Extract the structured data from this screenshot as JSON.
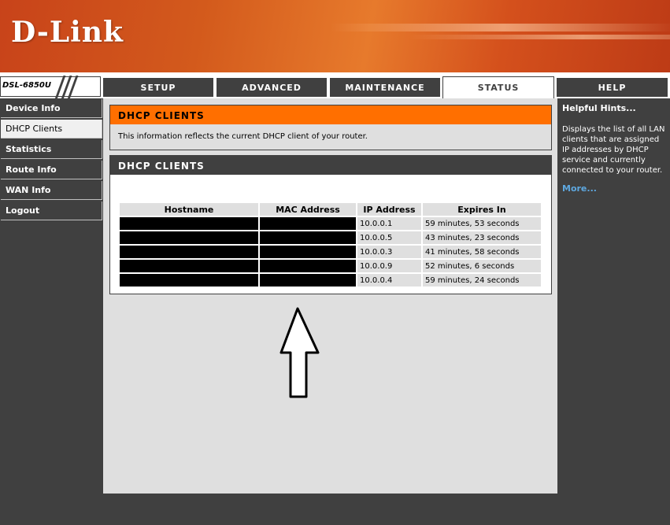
{
  "brand": {
    "logo_text": "D-Link",
    "model": "DSL-6850U"
  },
  "tabs": [
    {
      "label": "SETUP",
      "active": false
    },
    {
      "label": "ADVANCED",
      "active": false
    },
    {
      "label": "MAINTENANCE",
      "active": false
    },
    {
      "label": "STATUS",
      "active": true
    },
    {
      "label": "HELP",
      "active": false
    }
  ],
  "sidebar": {
    "items": [
      {
        "label": "Device Info",
        "active": false
      },
      {
        "label": "DHCP Clients",
        "active": true
      },
      {
        "label": "Statistics",
        "active": false
      },
      {
        "label": "Route Info",
        "active": false
      },
      {
        "label": "WAN Info",
        "active": false
      },
      {
        "label": "Logout",
        "active": false
      }
    ]
  },
  "main": {
    "info_title": "DHCP CLIENTS",
    "info_text": "This information reflects the current DHCP client of your router.",
    "table_title": "DHCP CLIENTS",
    "columns": [
      "Hostname",
      "MAC Address",
      "IP Address",
      "Expires In"
    ],
    "rows": [
      {
        "ip": "10.0.0.1",
        "expires": "59 minutes, 53 seconds"
      },
      {
        "ip": "10.0.0.5",
        "expires": "43 minutes, 23 seconds"
      },
      {
        "ip": "10.0.0.3",
        "expires": "41 minutes, 58 seconds"
      },
      {
        "ip": "10.0.0.9",
        "expires": "52 minutes, 6 seconds"
      },
      {
        "ip": "10.0.0.4",
        "expires": "59 minutes, 24 seconds"
      }
    ]
  },
  "help": {
    "heading": "Helpful Hints...",
    "text": "Displays the list of all LAN clients that are assigned IP addresses by DHCP service and currently connected to your router.",
    "more": "More..."
  },
  "colors": {
    "accent": "#ff6f00",
    "dark": "#404040",
    "panel": "#dfdfdf",
    "link": "#5ea8e0"
  },
  "icons": [
    "up-arrow-annotation-icon"
  ]
}
